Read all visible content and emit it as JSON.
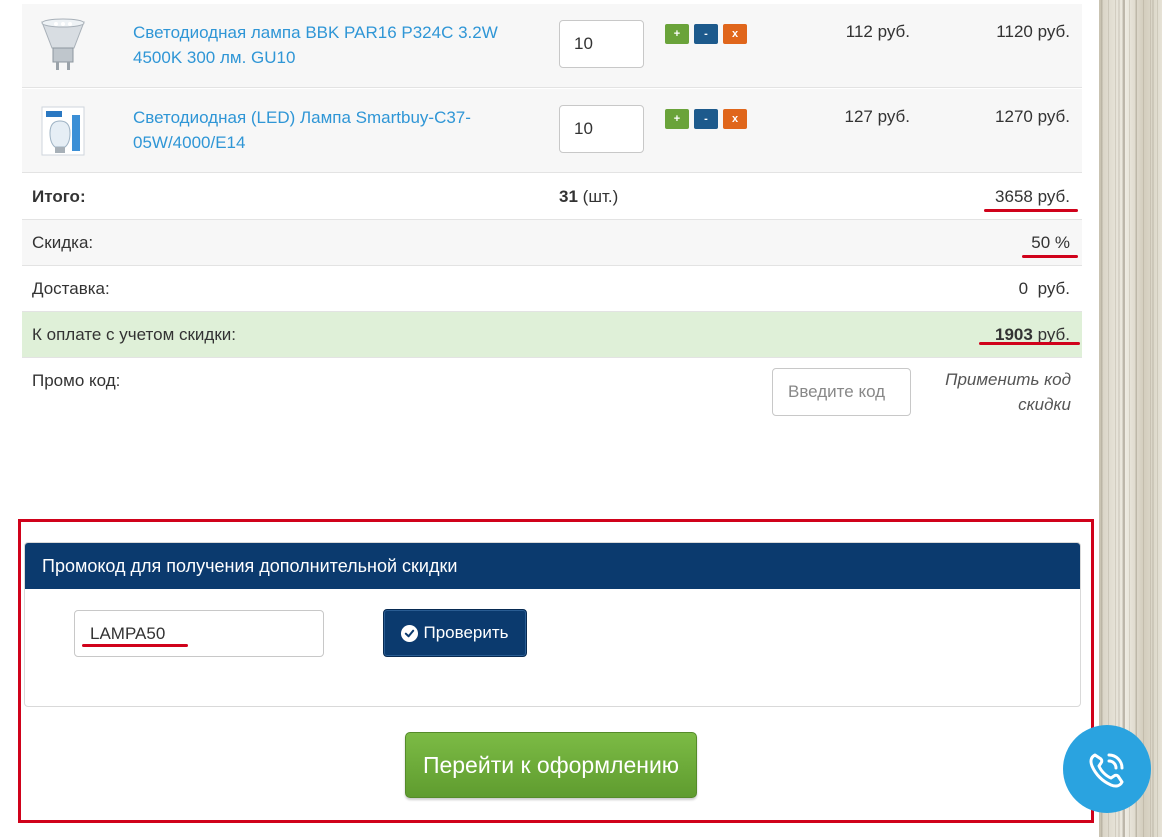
{
  "cart": {
    "items": [
      {
        "name": "Светодиодная лампа BBK PAR16 P324C 3.2W 4500K 300 лм. GU10",
        "qty": "10",
        "price": "112 руб.",
        "total": "1120 руб."
      },
      {
        "name": "Светодиодная (LED) Лампа Smartbuy-C37-05W/4000/E14",
        "qty": "10",
        "price": "127 руб.",
        "total": "1270 руб."
      }
    ],
    "buttons": {
      "plus": "+",
      "minus": "-",
      "remove": "x"
    }
  },
  "summary": {
    "total_label": "Итого:",
    "count_value": "31",
    "count_unit": "(шт.)",
    "total_value": "3658 руб.",
    "discount_label": "Скидка:",
    "discount_value": "50 %",
    "delivery_label": "Доставка:",
    "delivery_value": "0  руб.",
    "pay_label": "К оплате с учетом скидки:",
    "pay_amount": "1903",
    "pay_currency": "руб."
  },
  "promo": {
    "label": "Промо код:",
    "placeholder": "Введите код",
    "apply_link": "Применить код скидки"
  },
  "promo_panel": {
    "title": "Промокод для получения дополнительной скидки",
    "code_value": "LAMPA50",
    "check_label": "Проверить"
  },
  "checkout_label": "Перейти к оформлению",
  "colors": {
    "accent_navy": "#0b3a6e",
    "link_blue": "#2f96d6",
    "green": "#6aa33a",
    "orange": "#e0661b",
    "highlight_red": "#d0021b",
    "call_blue": "#2aa3e0"
  },
  "icons": {
    "check": "check-circle-icon",
    "call": "phone-icon"
  }
}
